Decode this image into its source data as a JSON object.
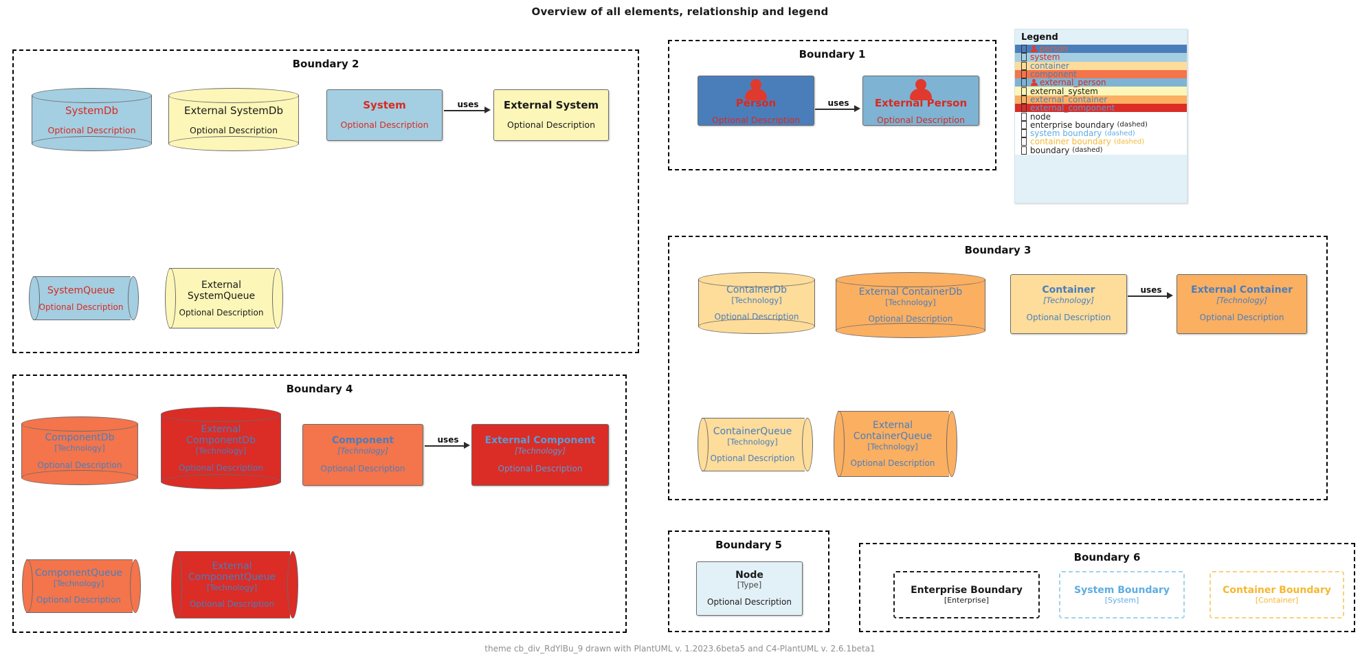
{
  "title": "Overview of all elements, relationship and legend",
  "footer": "theme cb_div_RdYlBu_9 drawn with PlantUML v. 1.2023.6beta5 and C4-PlantUML v. 2.6.1beta1",
  "labels": {
    "uses": "uses",
    "optional_description": "Optional Description",
    "technology": "[Technology]",
    "type": "[Type]"
  },
  "boundaries": {
    "b1": "Boundary 1",
    "b2": "Boundary 2",
    "b3": "Boundary 3",
    "b4": "Boundary 4",
    "b5": "Boundary 5",
    "b6": "Boundary 6"
  },
  "elements": {
    "person": {
      "name": "Person",
      "desc": "Optional Description"
    },
    "external_person": {
      "name": "External Person",
      "desc": "Optional Description"
    },
    "system_db": {
      "name": "SystemDb",
      "desc": "Optional Description"
    },
    "external_system_db": {
      "name": "External SystemDb",
      "desc": "Optional Description"
    },
    "system": {
      "name": "System",
      "desc": "Optional Description"
    },
    "external_system": {
      "name": "External System",
      "desc": "Optional Description"
    },
    "system_queue": {
      "name": "SystemQueue",
      "desc": "Optional Description"
    },
    "external_system_queue": {
      "name": "External\nSystemQueue",
      "desc": "Optional Description"
    },
    "container_db": {
      "name": "ContainerDb",
      "tech": "[Technology]",
      "desc": "Optional Description"
    },
    "external_container_db": {
      "name": "External ContainerDb",
      "tech": "[Technology]",
      "desc": "Optional Description"
    },
    "container": {
      "name": "Container",
      "tech": "[Technology]",
      "desc": "Optional Description"
    },
    "external_container": {
      "name": "External Container",
      "tech": "[Technology]",
      "desc": "Optional Description"
    },
    "container_queue": {
      "name": "ContainerQueue",
      "tech": "[Technology]",
      "desc": "Optional Description"
    },
    "external_container_queue": {
      "name": "External\nContainerQueue",
      "tech": "[Technology]",
      "desc": "Optional Description"
    },
    "component_db": {
      "name": "ComponentDb",
      "tech": "[Technology]",
      "desc": "Optional Description"
    },
    "external_component_db": {
      "name": "External\nComponentDb",
      "tech": "[Technology]",
      "desc": "Optional Description"
    },
    "component": {
      "name": "Component",
      "tech": "[Technology]",
      "desc": "Optional Description"
    },
    "external_component": {
      "name": "External Component",
      "tech": "[Technology]",
      "desc": "Optional Description"
    },
    "component_queue": {
      "name": "ComponentQueue",
      "tech": "[Technology]",
      "desc": "Optional Description"
    },
    "external_component_queue": {
      "name": "External\nComponentQueue",
      "tech": "[Technology]",
      "desc": "Optional Description"
    },
    "node": {
      "name": "Node",
      "tech": "[Type]",
      "desc": "Optional Description"
    },
    "enterprise_boundary": {
      "name": "Enterprise Boundary",
      "tech": "[Enterprise]"
    },
    "system_boundary": {
      "name": "System Boundary",
      "tech": "[System]"
    },
    "container_boundary": {
      "name": "Container Boundary",
      "tech": "[Container]"
    }
  },
  "legend": {
    "title": "Legend",
    "items": [
      {
        "label": "person",
        "sub": "",
        "fill": "#4A7EBB",
        "text": "#E8602C",
        "icon": "person-icon"
      },
      {
        "label": "system",
        "sub": "",
        "fill": "#A4CEE2",
        "text": "#D62B20",
        "icon": ""
      },
      {
        "label": "container",
        "sub": "",
        "fill": "#FEDC9A",
        "text": "#4A7EBB",
        "icon": ""
      },
      {
        "label": "component",
        "sub": "",
        "fill": "#F4744B",
        "text": "#4A7EBB",
        "icon": ""
      },
      {
        "label": "external_person",
        "sub": "",
        "fill": "#7EB3D4",
        "text": "#D62B20",
        "icon": "person-icon"
      },
      {
        "label": "external_system",
        "sub": "",
        "fill": "#FCF6B8",
        "text": "#222222",
        "icon": ""
      },
      {
        "label": "external_container",
        "sub": "",
        "fill": "#FBAF61",
        "text": "#4A7EBB",
        "icon": ""
      },
      {
        "label": "external_component",
        "sub": "",
        "fill": "#DB2C26",
        "text": "#5B9BD5",
        "icon": ""
      },
      {
        "label": "node",
        "sub": "",
        "fill": "#ffffff",
        "text": "#222222",
        "icon": ""
      },
      {
        "label": "enterprise boundary",
        "sub": "(dashed)",
        "fill": "#ffffff",
        "text": "#222222",
        "icon": ""
      },
      {
        "label": "system boundary",
        "sub": "(dashed)",
        "fill": "#ffffff",
        "text": "#5DADE2",
        "icon": ""
      },
      {
        "label": "container boundary",
        "sub": "(dashed)",
        "fill": "#ffffff",
        "text": "#F5B731",
        "icon": ""
      },
      {
        "label": "boundary",
        "sub": "(dashed)",
        "fill": "#ffffff",
        "text": "#222222",
        "icon": ""
      }
    ]
  },
  "colors": {
    "person_fill": "#4A7EBB",
    "external_person_fill": "#7EB3D4",
    "system_fill": "#A4CEE2",
    "external_system_fill": "#FCF6B8",
    "container_fill": "#FEDC9A",
    "external_container_fill": "#FBAF61",
    "component_fill": "#F4744B",
    "external_component_fill": "#DB2C26",
    "node_fill": "#E2F1F7",
    "red_text": "#D62B20",
    "blue_text": "#4A7EBB",
    "light_blue_text": "#5B9BD5",
    "black_text": "#1A1A1A",
    "system_boundary_color": "#5DADE2",
    "container_boundary_color": "#F5B731"
  }
}
